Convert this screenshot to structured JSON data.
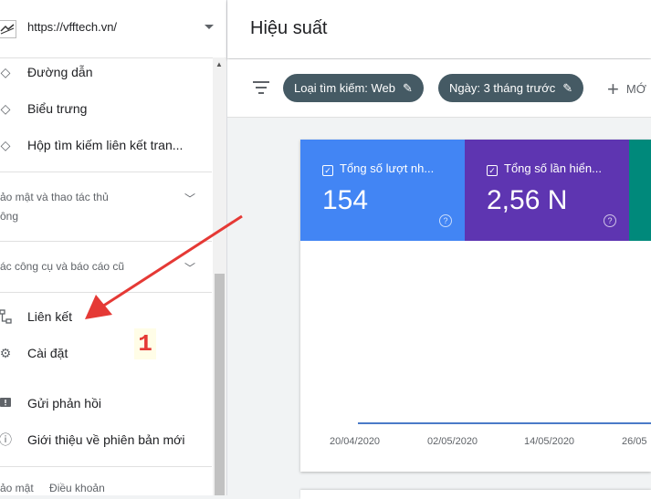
{
  "property": {
    "url": "https://vfftech.vn/"
  },
  "sidebar": {
    "items_top": [
      {
        "label": "Đường dẫn",
        "icon": "layers-icon"
      },
      {
        "label": "Biểu trưng",
        "icon": "layers-icon"
      },
      {
        "label": "Hộp tìm kiếm liên kết tran...",
        "icon": "layers-icon"
      }
    ],
    "section_security_line1": "ảo mật và thao tác thủ",
    "section_security_line2": "ông",
    "section_legacy": "ác công cụ và báo cáo cũ",
    "items_bottom": [
      {
        "label": "Liên kết",
        "icon": "links-icon"
      },
      {
        "label": "Cài đặt",
        "icon": "gear-icon"
      },
      {
        "label": "Gửi phản hồi",
        "icon": "feedback-icon"
      },
      {
        "label": "Giới thiệu về phiên bản mới",
        "icon": "info-icon"
      }
    ],
    "footer": {
      "privacy": "ảo mật",
      "terms": "Điều khoản"
    }
  },
  "annotation": {
    "badge": "1",
    "arrow_color": "#e53935"
  },
  "header": {
    "title": "Hiệu suất"
  },
  "filters": {
    "search_type": "Loại tìm kiếm: Web",
    "date": "Ngày: 3 tháng trước",
    "add_label": "MỚ"
  },
  "metrics": [
    {
      "label": "Tổng số lượt nh...",
      "value": "154",
      "color": "#4285f4"
    },
    {
      "label": "Tổng số lần hiển...",
      "value": "2,56 N",
      "color": "#5e35b1"
    },
    {
      "label": "",
      "value": "",
      "color": "#00897b"
    }
  ],
  "chart_data": {
    "type": "line",
    "x_ticks": [
      "20/04/2020",
      "02/05/2020",
      "14/05/2020",
      "26/05"
    ]
  }
}
